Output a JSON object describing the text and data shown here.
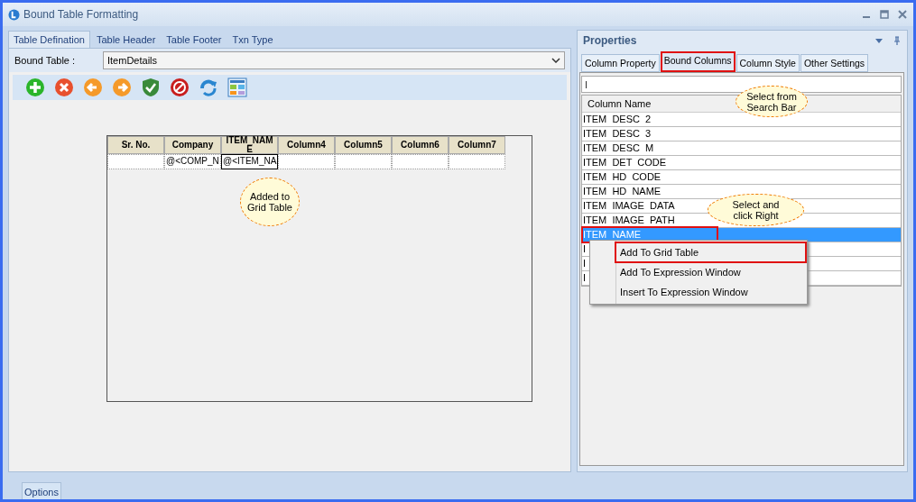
{
  "window": {
    "title": "Bound Table Formatting"
  },
  "left_tabs": [
    {
      "label": "Table Defination",
      "selected": true
    },
    {
      "label": "Table Header",
      "selected": false
    },
    {
      "label": "Table Footer",
      "selected": false
    },
    {
      "label": "Txn Type",
      "selected": false
    }
  ],
  "bound_table": {
    "label": "Bound Table :",
    "value": "ItemDetails"
  },
  "grid": {
    "columns": [
      "Sr. No.",
      "Company",
      "ITEM_NAME",
      "Column4",
      "Column5",
      "Column6",
      "Column7"
    ],
    "cells": [
      {
        "text": "",
        "selected": false
      },
      {
        "text": "@<COMP_N",
        "selected": false
      },
      {
        "text": "@<ITEM_NA",
        "selected": true
      },
      {
        "text": "",
        "selected": false
      },
      {
        "text": "",
        "selected": false
      },
      {
        "text": "",
        "selected": false
      },
      {
        "text": "",
        "selected": false
      }
    ]
  },
  "properties": {
    "title": "Properties",
    "tabs": [
      {
        "label": "Column Property",
        "selected": false,
        "highlighted": false
      },
      {
        "label": "Bound Columns",
        "selected": true,
        "highlighted": true
      },
      {
        "label": "Column Style",
        "selected": false,
        "highlighted": false
      },
      {
        "label": "Other Settings",
        "selected": false,
        "highlighted": false
      }
    ],
    "search": {
      "value": "I"
    },
    "list_header": "Column Name",
    "rows": [
      {
        "text": "ITEM  DESC  2",
        "selected": false,
        "highlighted": false
      },
      {
        "text": "ITEM  DESC  3",
        "selected": false,
        "highlighted": false
      },
      {
        "text": "ITEM  DESC  M",
        "selected": false,
        "highlighted": false
      },
      {
        "text": "ITEM  DET  CODE",
        "selected": false,
        "highlighted": false
      },
      {
        "text": "ITEM  HD  CODE",
        "selected": false,
        "highlighted": false
      },
      {
        "text": "ITEM  HD  NAME",
        "selected": false,
        "highlighted": false
      },
      {
        "text": "ITEM  IMAGE  DATA",
        "selected": false,
        "highlighted": false
      },
      {
        "text": "ITEM  IMAGE  PATH",
        "selected": false,
        "highlighted": false
      },
      {
        "text": "ITEM  NAME",
        "selected": true,
        "highlighted": true
      },
      {
        "text": "I",
        "selected": false
      },
      {
        "text": "I",
        "selected": false
      },
      {
        "text": "I",
        "selected": false
      }
    ]
  },
  "context_menu": [
    {
      "label": "Add To Grid Table",
      "highlighted": true
    },
    {
      "label": "Add To Expression Window",
      "highlighted": false
    },
    {
      "label": "Insert To Expression Window",
      "highlighted": false
    }
  ],
  "callouts": [
    {
      "text": "Added to Grid Table"
    },
    {
      "text": "Select from Search Bar"
    },
    {
      "text": "Select and click Right"
    }
  ],
  "bottom_tab": "Options"
}
